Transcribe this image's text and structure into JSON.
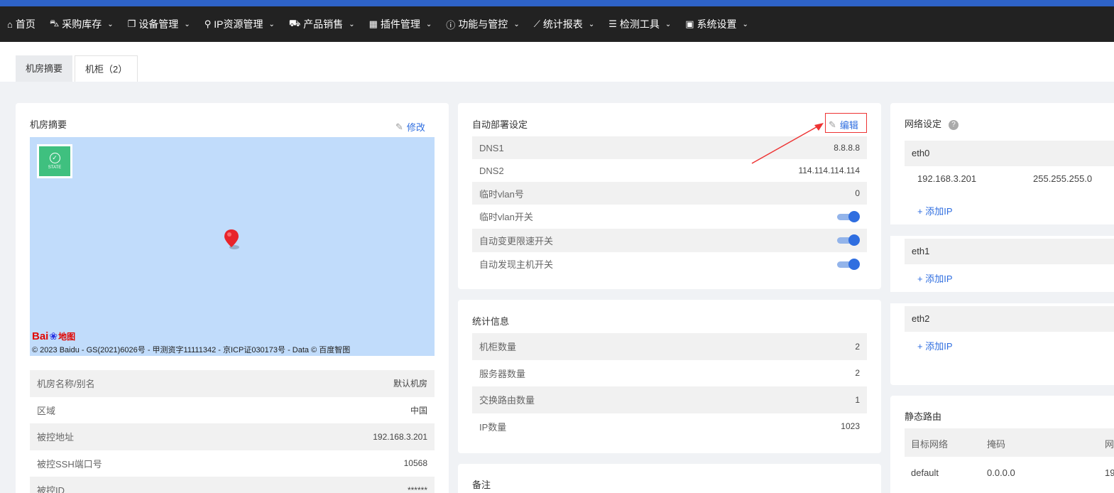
{
  "nav": [
    {
      "icon": "home-icon",
      "glyph": "⌂",
      "label": "首页",
      "caret": false
    },
    {
      "icon": "car-icon",
      "glyph": "⛍",
      "label": "采购库存",
      "caret": true
    },
    {
      "icon": "cube-icon",
      "glyph": "❒",
      "label": "设备管理",
      "caret": true
    },
    {
      "icon": "map-marker-icon",
      "glyph": "⚲",
      "label": "IP资源管理",
      "caret": true
    },
    {
      "icon": "cart-icon",
      "glyph": "⛟",
      "label": "产品销售",
      "caret": true
    },
    {
      "icon": "grid-icon",
      "glyph": "▦",
      "label": "插件管理",
      "caret": true
    },
    {
      "icon": "info-icon",
      "glyph": "ⓘ",
      "label": "功能与管控",
      "caret": true
    },
    {
      "icon": "line-chart-icon",
      "glyph": "⟋",
      "label": "统计报表",
      "caret": true
    },
    {
      "icon": "list-icon",
      "glyph": "☰",
      "label": "检测工具",
      "caret": true
    },
    {
      "icon": "th-large-icon",
      "glyph": "▣",
      "label": "系统设置",
      "caret": true
    }
  ],
  "tabs": [
    {
      "label": "机房摘要"
    },
    {
      "label": "机柜（2）"
    }
  ],
  "summary": {
    "title": "机房摘要",
    "edit_label": "修改",
    "map": {
      "state_label": "STATE",
      "logo_text": "Bai",
      "logo_ditu": "地图",
      "copyright": "© 2023 Baidu - GS(2021)6026号 - 甲测资字11111342 - 京ICP证030173号 - Data © 百度智图"
    },
    "rows": [
      {
        "key": "机房名称/别名",
        "value": "默认机房"
      },
      {
        "key": "区域",
        "value": "中国"
      },
      {
        "key": "被控地址",
        "value": "192.168.3.201"
      },
      {
        "key": "被控SSH端口号",
        "value": "10568"
      },
      {
        "key": "被控ID",
        "value": "******"
      }
    ]
  },
  "deploy": {
    "title": "自动部署设定",
    "edit_label": "编辑",
    "rows": [
      {
        "key": "DNS1",
        "value": "8.8.8.8"
      },
      {
        "key": "DNS2",
        "value": "114.114.114.114"
      },
      {
        "key": "临时vlan号",
        "value": "0"
      }
    ],
    "switches": [
      {
        "key": "临时vlan开关",
        "on": true
      },
      {
        "key": "自动变更限速开关",
        "on": true
      },
      {
        "key": "自动发现主机开关",
        "on": true
      }
    ]
  },
  "stats": {
    "title": "统计信息",
    "rows": [
      {
        "key": "机柜数量",
        "value": "2"
      },
      {
        "key": "服务器数量",
        "value": "2"
      },
      {
        "key": "交换路由数量",
        "value": "1"
      },
      {
        "key": "IP数量",
        "value": "1023"
      }
    ]
  },
  "notes": {
    "title": "备注"
  },
  "network": {
    "title": "网络设定",
    "help": "?",
    "eth0": {
      "name": "eth0",
      "ip": "192.168.3.201",
      "mask": "255.255.255.0",
      "add_label": "+ 添加IP"
    },
    "eth1": {
      "name": "eth1",
      "add_label": "+ 添加IP"
    },
    "eth2": {
      "name": "eth2",
      "add_label": "+ 添加IP"
    }
  },
  "routes": {
    "title": "静态路由",
    "headers": [
      "目标网络",
      "掩码",
      "网"
    ],
    "row": [
      "default",
      "0.0.0.0",
      "19"
    ]
  },
  "colors": {
    "accent": "#2f6ee0",
    "topstripe": "#2e63c8",
    "navbar": "#222222",
    "state": "#3fc07f",
    "annotation": "#e33333"
  }
}
